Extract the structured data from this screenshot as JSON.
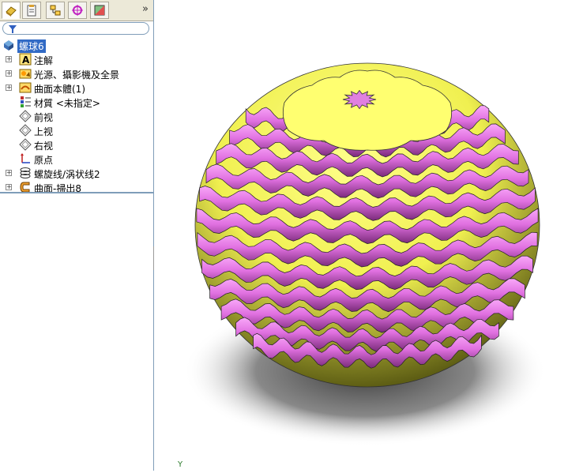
{
  "feature_tree": {
    "root": {
      "label": "螺球6",
      "icon": "part-icon"
    },
    "items": [
      {
        "label": "注解",
        "icon": "annotation-icon",
        "expandable": true
      },
      {
        "label": "光源、攝影機及全景",
        "icon": "lights-camera-icon",
        "expandable": true
      },
      {
        "label": "曲面本體(1)",
        "icon": "surface-body-icon",
        "expandable": true
      },
      {
        "label": "材質 <未指定>",
        "icon": "material-icon",
        "expandable": false
      },
      {
        "label": "前视",
        "icon": "plane-icon",
        "expandable": false
      },
      {
        "label": "上视",
        "icon": "plane-icon",
        "expandable": false
      },
      {
        "label": "右视",
        "icon": "plane-icon",
        "expandable": false
      },
      {
        "label": "原点",
        "icon": "origin-icon",
        "expandable": false
      },
      {
        "label": "螺旋线/涡状线2",
        "icon": "helix-icon",
        "expandable": true
      },
      {
        "label": "曲面-掃出8",
        "icon": "surface-sweep-icon",
        "expandable": true
      }
    ]
  },
  "toolbar": {
    "tabs": [
      "feature-manager-tab",
      "property-manager-tab",
      "configuration-manager-tab",
      "dimxpert-tab",
      "display-manager-tab"
    ],
    "expand_label": "»"
  },
  "viewport": {
    "axis_label": "Y",
    "model_colors": {
      "magenta": "#e070e0",
      "yellow": "#f5f55a",
      "dark_yellow": "#8a8a2a"
    }
  }
}
